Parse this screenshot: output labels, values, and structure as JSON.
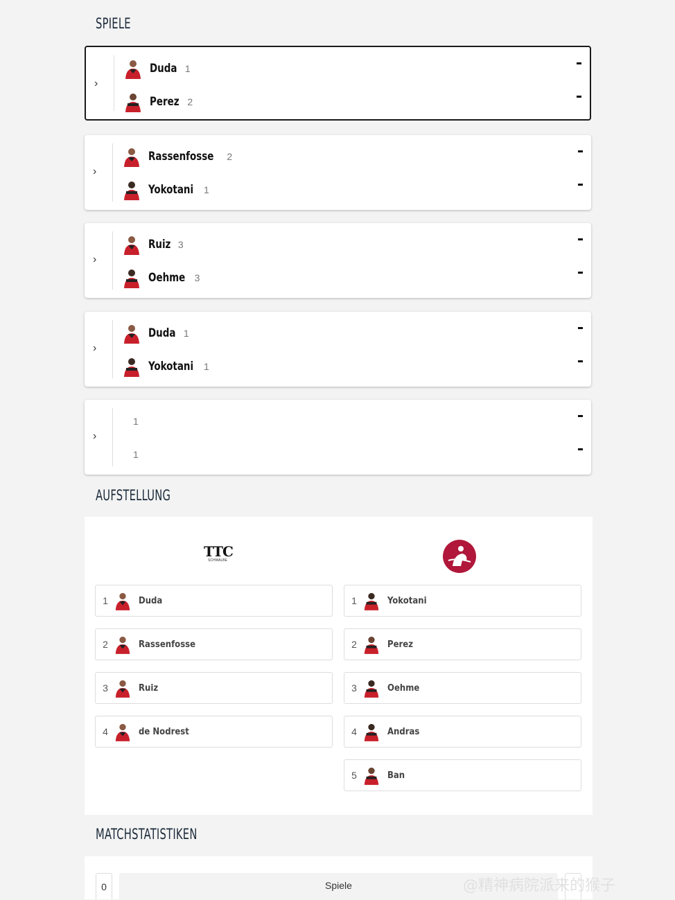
{
  "sections": {
    "games_title": "SPIELE",
    "lineup_title": "AUFSTELLUNG",
    "stats_title": "MATCHSTATISTIKEN"
  },
  "games": [
    {
      "home": {
        "name": "Duda",
        "pos": "1"
      },
      "away": {
        "name": "Perez",
        "pos": "2"
      },
      "home_score": "-",
      "away_score": "-"
    },
    {
      "home": {
        "name": "Rassenfosse",
        "pos": "2"
      },
      "away": {
        "name": "Yokotani",
        "pos": "1"
      },
      "home_score": "-",
      "away_score": "-"
    },
    {
      "home": {
        "name": "Ruiz",
        "pos": "3"
      },
      "away": {
        "name": "Oehme",
        "pos": "3"
      },
      "home_score": "-",
      "away_score": "-"
    },
    {
      "home": {
        "name": "Duda",
        "pos": "1"
      },
      "away": {
        "name": "Yokotani",
        "pos": "1"
      },
      "home_score": "-",
      "away_score": "-"
    },
    {
      "home": {
        "name": "",
        "pos": "1"
      },
      "away": {
        "name": "",
        "pos": "1"
      },
      "home_score": "-",
      "away_score": "-"
    }
  ],
  "lineup": {
    "home_logo_text": "TTC",
    "home_logo_sub": "SCHWALBE",
    "home": [
      {
        "num": "1",
        "name": "Duda"
      },
      {
        "num": "2",
        "name": "Rassenfosse"
      },
      {
        "num": "3",
        "name": "Ruiz"
      },
      {
        "num": "4",
        "name": "de Nodrest"
      }
    ],
    "away": [
      {
        "num": "1",
        "name": "Yokotani"
      },
      {
        "num": "2",
        "name": "Perez"
      },
      {
        "num": "3",
        "name": "Oehme"
      },
      {
        "num": "4",
        "name": "Andras"
      },
      {
        "num": "5",
        "name": "Ban"
      }
    ]
  },
  "stats": {
    "home_value": "0",
    "label": "Spiele"
  },
  "watermark": "@精神病院派来的猴子",
  "colors": {
    "accent": "#b0173a",
    "title": "#1b2a3a",
    "jersey": "#c8202b"
  }
}
